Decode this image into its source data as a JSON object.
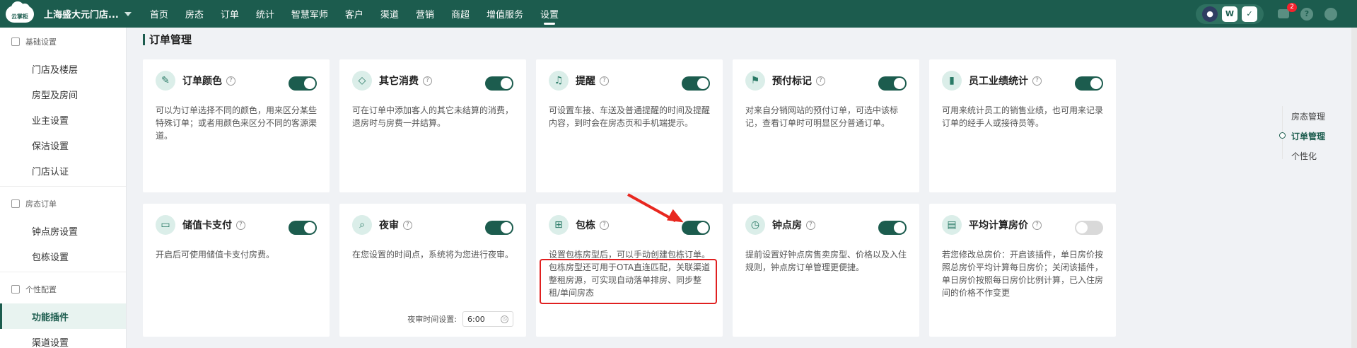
{
  "topbar": {
    "logo_text": "云掌柜",
    "store_name": "上海盛大元门店...",
    "nav": [
      "首页",
      "房态",
      "订单",
      "统计",
      "智慧军师",
      "客户",
      "渠道",
      "营销",
      "商超",
      "增值服务",
      "设置"
    ],
    "active_nav": "设置",
    "notification_count": "2",
    "help_icon": "?"
  },
  "sidebar": {
    "groups": [
      {
        "title": "基础设置",
        "items": [
          "门店及楼层",
          "房型及房间",
          "业主设置",
          "保洁设置",
          "门店认证"
        ]
      },
      {
        "title": "房态订单",
        "items": [
          "钟点房设置",
          "包栋设置"
        ]
      },
      {
        "title": "个性配置",
        "items": [
          "功能插件",
          "渠道设置"
        ]
      }
    ],
    "active_item": "功能插件"
  },
  "main": {
    "section_title": "订单管理",
    "cards": [
      {
        "title": "订单颜色",
        "icon": "✎",
        "enabled": true,
        "desc": "可以为订单选择不同的颜色，用来区分某些特殊订单；或者用颜色来区分不同的客源渠道。"
      },
      {
        "title": "其它消费",
        "icon": "◇",
        "enabled": true,
        "desc": "可在订单中添加客人的其它未结算的消费，退房时与房费一并结算。"
      },
      {
        "title": "提醒",
        "icon": "♫",
        "enabled": true,
        "desc": "可设置车接、车送及普通提醒的时间及提醒内容，到时会在房态页和手机端提示。"
      },
      {
        "title": "预付标记",
        "icon": "⚑",
        "enabled": true,
        "desc": "对来自分销网站的预付订单，可选中该标记，查看订单时可明显区分普通订单。"
      },
      {
        "title": "员工业绩统计",
        "icon": "▮",
        "enabled": true,
        "desc": "可用来统计员工的销售业绩，也可用来记录订单的经手人或接待员等。"
      },
      {
        "title": "储值卡支付",
        "icon": "▭",
        "enabled": true,
        "desc": "开启后可使用储值卡支付房费。"
      },
      {
        "title": "夜审",
        "icon": "⌕",
        "enabled": true,
        "desc": "在您设置的时间点，系统将为您进行夜审。",
        "setting_label": "夜审时间设置:",
        "setting_value": "6:00"
      },
      {
        "title": "包栋",
        "icon": "⊞",
        "enabled": true,
        "desc": "设置包栋房型后，可以手动创建包栋订单。包栋房型还可用于OTA直连匹配，关联渠道整租房源，可实现自动落单排房、同步整租/单间房态"
      },
      {
        "title": "钟点房",
        "icon": "◷",
        "enabled": true,
        "desc": "提前设置好钟点房售卖房型、价格以及入住规则，钟点房订单管理更便捷。"
      },
      {
        "title": "平均计算房价",
        "icon": "▤",
        "enabled": false,
        "desc": "若您修改总房价：开启该插件，单日房价按照总房价平均计算每日房价；关闭该插件，单日房价按照每日房价比例计算，已入住房间的价格不作变更"
      }
    ]
  },
  "anchor_nav": {
    "items": [
      "房态管理",
      "订单管理",
      "个性化"
    ],
    "active": "订单管理"
  }
}
